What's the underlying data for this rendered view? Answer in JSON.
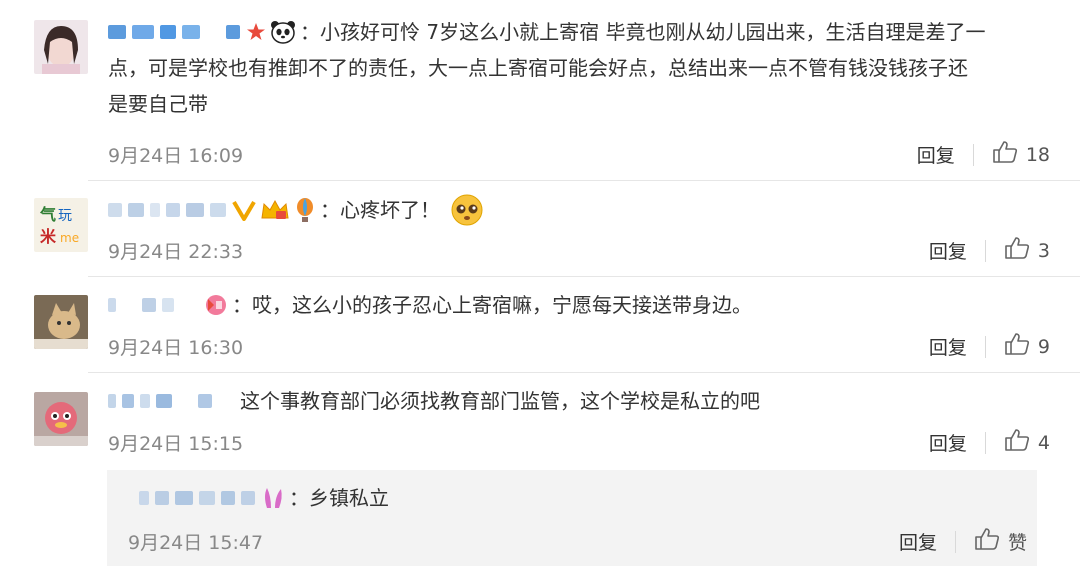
{
  "comments": [
    {
      "text_intro": "：小孩好可怜 7岁这么小就上寄宿 毕竟也刚从幼儿园出来，生活自理是差了一",
      "text_line2": "点，可是学校也有推卸不了的责任，大一点上寄宿可能会好点，总结出来一点不管有钱没钱孩子还",
      "text_line3": "是要自己带",
      "time": "9月24日 16:09",
      "reply": "回复",
      "likes": "18"
    },
    {
      "text": "：心疼坏了！",
      "time": "9月24日 22:33",
      "reply": "回复",
      "likes": "3"
    },
    {
      "text": "：哎，这么小的孩子忍心上寄宿嘛，宁愿每天接送带身边。",
      "time": "9月24日 16:30",
      "reply": "回复",
      "likes": "9"
    },
    {
      "text": "这个事教育部门必须找教育部门监管，这个学校是私立的吧",
      "time": "9月24日 15:15",
      "reply": "回复",
      "likes": "4",
      "sub_reply": {
        "text": "：乡镇私立",
        "time": "9月24日 15:47",
        "reply": "回复",
        "likes": "赞"
      }
    }
  ],
  "colors": {
    "text": "#333333",
    "time": "#888888",
    "blur_blue": "#3d8de0",
    "sub_bg": "#f3f3f3"
  }
}
